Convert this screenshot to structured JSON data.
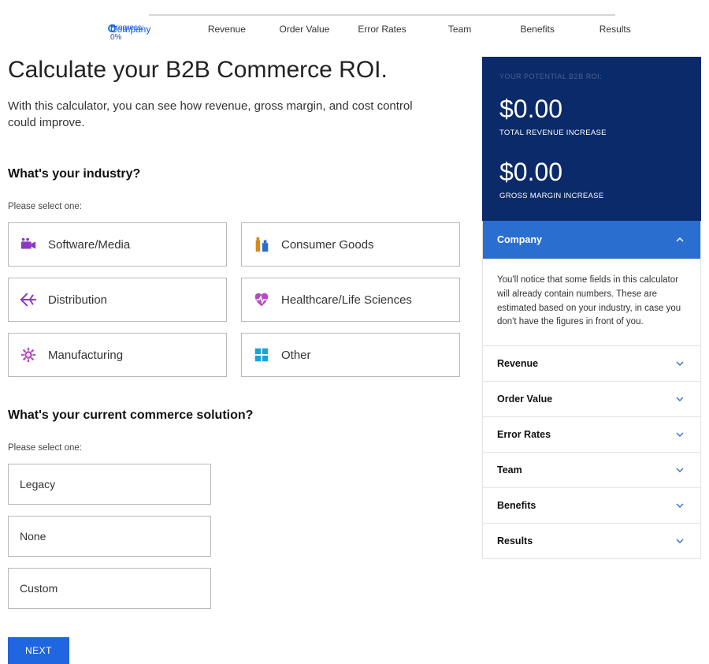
{
  "progress": {
    "label": "Progress:",
    "percent": "0%"
  },
  "steps": [
    "Company",
    "Revenue",
    "Order Value",
    "Error Rates",
    "Team",
    "Benefits",
    "Results"
  ],
  "title": "Calculate your B2B Commerce ROI.",
  "intro": "With this calculator, you can see how revenue, gross margin, and cost control could improve.",
  "q1": {
    "heading": "What's your industry?",
    "hint": "Please select one:",
    "options": [
      {
        "label": "Software/Media",
        "icon": "camera-icon"
      },
      {
        "label": "Consumer Goods",
        "icon": "bottle-icon"
      },
      {
        "label": "Distribution",
        "icon": "plane-icon"
      },
      {
        "label": "Healthcare/Life Sciences",
        "icon": "heart-icon"
      },
      {
        "label": "Manufacturing",
        "icon": "gear-icon"
      },
      {
        "label": "Other",
        "icon": "grid-icon"
      }
    ]
  },
  "q2": {
    "heading": "What's your current commerce solution?",
    "hint": "Please select one:",
    "options": [
      "Legacy",
      "None",
      "Custom"
    ]
  },
  "nextLabel": "NEXT",
  "roi": {
    "eyebrow": "YOUR POTENTIAL B2B ROI:",
    "revVal": "$0.00",
    "revLbl": "TOTAL REVENUE INCREASE",
    "marginVal": "$0.00",
    "marginLbl": "GROSS MARGIN INCREASE"
  },
  "accordion": {
    "open": {
      "title": "Company",
      "body": "You'll notice that some fields in this calculator will already contain numbers. These are estimated based on your industry, in case you don't have the figures in front of you."
    },
    "rest": [
      "Revenue",
      "Order Value",
      "Error Rates",
      "Team",
      "Benefits",
      "Results"
    ]
  }
}
